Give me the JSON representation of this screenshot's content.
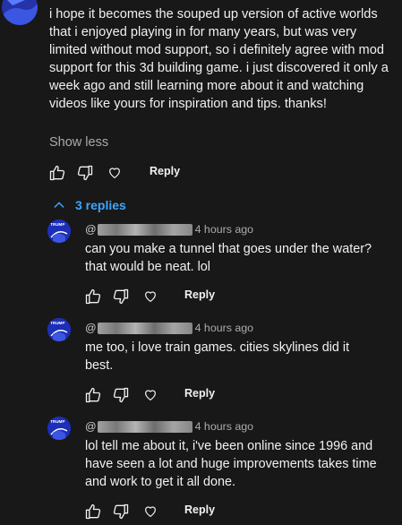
{
  "comment": {
    "text": "i hope it becomes the souped up version of active worlds that i enjoyed playing in for many years, but was very limited without mod support, so i definitely agree with mod support for this 3d building game. i just discovered it only a week ago and still learning more about it and watching videos like yours for inspiration and tips. thanks!",
    "show_less_label": "Show less",
    "reply_label": "Reply"
  },
  "replies_toggle": {
    "label": "3 replies",
    "icon": "chevron-up-icon"
  },
  "replies": [
    {
      "handle_prefix": "@",
      "time": "4 hours ago",
      "avatar_text": "TRUMP",
      "text": "can you make a tunnel that goes under the water? that would be neat. lol",
      "reply_label": "Reply"
    },
    {
      "handle_prefix": "@",
      "time": "4 hours ago",
      "avatar_text": "TRUMP",
      "text": "me too, i love train games. cities skylines did it best.",
      "reply_label": "Reply"
    },
    {
      "handle_prefix": "@",
      "time": "4 hours ago",
      "avatar_text": "TRUMP",
      "text": "lol tell me about it, i've been online since 1996 and have seen a lot and huge improvements takes time and work to get it all done.",
      "reply_label": "Reply"
    }
  ],
  "colors": {
    "background": "#181818",
    "text_primary": "#f1f1f1",
    "text_secondary": "#aaaaaa",
    "link_blue": "#3ea6ff",
    "avatar_blue": "#1d2a8f"
  },
  "icons": [
    "like-icon",
    "dislike-icon",
    "heart-icon",
    "chevron-up-icon"
  ]
}
